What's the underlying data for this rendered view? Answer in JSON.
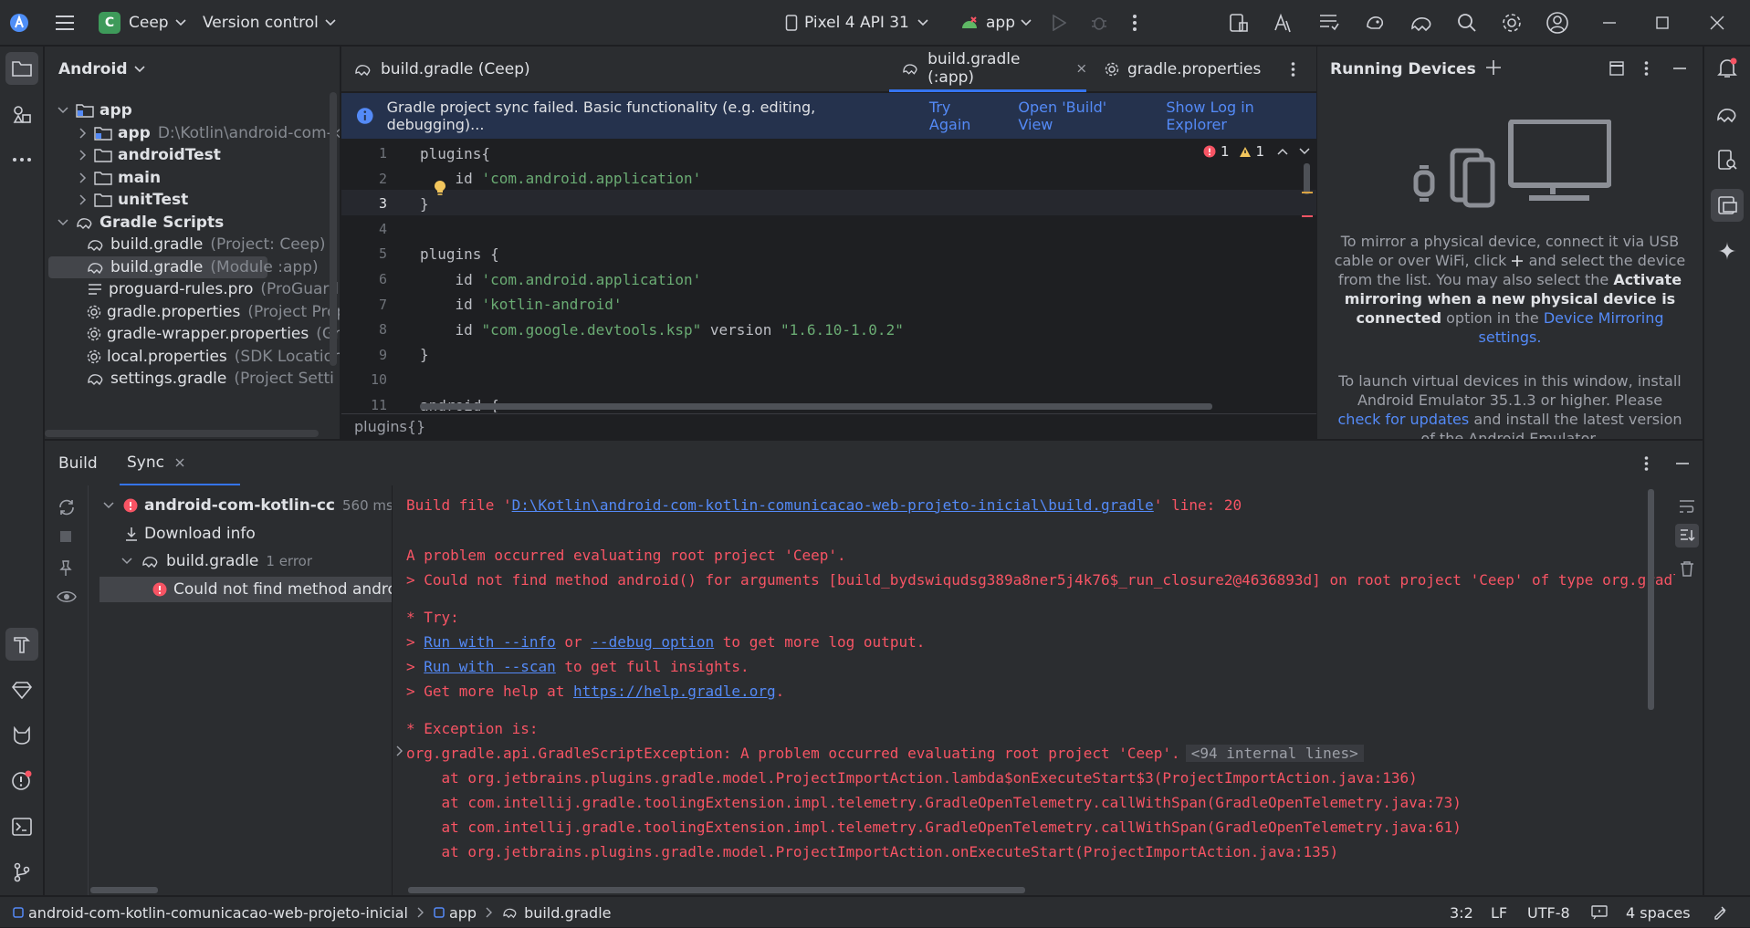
{
  "titlebar": {
    "project_badge": "C",
    "project_name": "Ceep",
    "vcs_label": "Version control",
    "device": "Pixel 4 API 31",
    "run_config": "app"
  },
  "project_panel": {
    "view_label": "Android",
    "tree": [
      {
        "label": "app",
        "hint": "",
        "level": 0,
        "expanded": true,
        "icon": "folder-module-icon"
      },
      {
        "label": "app",
        "hint": "D:\\Kotlin\\android-com-ko",
        "level": 1,
        "expanded": false,
        "icon": "folder-module-icon"
      },
      {
        "label": "androidTest",
        "hint": "",
        "level": 1,
        "expanded": false,
        "icon": "folder-icon"
      },
      {
        "label": "main",
        "hint": "",
        "level": 1,
        "expanded": false,
        "icon": "folder-icon"
      },
      {
        "label": "unitTest",
        "hint": "",
        "level": 1,
        "expanded": false,
        "icon": "folder-icon"
      },
      {
        "label": "Gradle Scripts",
        "hint": "",
        "level": 0,
        "expanded": true,
        "icon": "gradle-icon"
      },
      {
        "label": "build.gradle",
        "hint": "(Project: Ceep)",
        "level": 1,
        "icon": "gradle-icon"
      },
      {
        "label": "build.gradle",
        "hint": "(Module :app)",
        "level": 1,
        "icon": "gradle-icon",
        "selected": true
      },
      {
        "label": "proguard-rules.pro",
        "hint": "(ProGuard R",
        "level": 1,
        "icon": "text-file-icon"
      },
      {
        "label": "gradle.properties",
        "hint": "(Project Prop",
        "level": 1,
        "icon": "gear-icon"
      },
      {
        "label": "gradle-wrapper.properties",
        "hint": "(Gra",
        "level": 1,
        "icon": "gear-icon"
      },
      {
        "label": "local.properties",
        "hint": "(SDK Location",
        "level": 1,
        "icon": "gear-icon"
      },
      {
        "label": "settings.gradle",
        "hint": "(Project Setti",
        "level": 1,
        "icon": "gradle-icon"
      }
    ]
  },
  "editor": {
    "tabs": [
      {
        "label": "build.gradle (Ceep)",
        "active": false
      },
      {
        "label": "build.gradle (:app)",
        "active": true
      },
      {
        "label": "gradle.properties",
        "active": false
      }
    ],
    "notice": {
      "text": "Gradle project sync failed. Basic functionality (e.g. editing, debugging)...",
      "try_again": "Try Again",
      "open_build": "Open 'Build' View",
      "show_log": "Show Log in Explorer"
    },
    "inspections": {
      "errors": "1",
      "warnings": "1"
    },
    "lines": [
      {
        "n": "1",
        "text": "plugins{"
      },
      {
        "n": "2",
        "text": "    id 'com.android.application'"
      },
      {
        "n": "3",
        "text": "}"
      },
      {
        "n": "4",
        "text": ""
      },
      {
        "n": "5",
        "text": "plugins {"
      },
      {
        "n": "6",
        "text": "    id 'com.android.application'"
      },
      {
        "n": "7",
        "text": "    id 'kotlin-android'"
      },
      {
        "n": "8",
        "text": "    id \"com.google.devtools.ksp\" version \"1.6.10-1.0.2\""
      },
      {
        "n": "9",
        "text": "}"
      },
      {
        "n": "10",
        "text": ""
      },
      {
        "n": "11",
        "text": "android {"
      }
    ],
    "breadcrumb": "plugins{}"
  },
  "devices": {
    "title": "Running Devices",
    "p1_a": "To mirror a physical device, connect it via USB cable or over WiFi, click",
    "p1_b": "and select the device from the list. You may also select the",
    "p1_bold": "Activate mirroring when a new physical device is connected",
    "p1_c": "option in the",
    "p1_link": "Device Mirroring settings.",
    "p2_a": "To launch virtual devices in this window, install Android Emulator 35.1.3 or higher. Please",
    "p2_link": "check for updates",
    "p2_b": "and install the latest version of the Android Emulator."
  },
  "build": {
    "tab_build": "Build",
    "tab_sync": "Sync",
    "tree": [
      {
        "label": "android-com-kotlin-cc",
        "hint": "560 ms",
        "level": 0
      },
      {
        "label": "Download info",
        "hint": "",
        "level": 1
      },
      {
        "label": "build.gradle",
        "hint": "1 error",
        "level": 1
      },
      {
        "label": "Could not find method andro",
        "hint": "",
        "level": 2
      }
    ],
    "console": {
      "l1_pre": "Build file '",
      "l1_link": "D:\\Kotlin\\android-com-kotlin-comunicacao-web-projeto-inicial\\build.gradle",
      "l1_post": "' line: 20",
      "l2": "A problem occurred evaluating root project 'Ceep'.",
      "l3": "> Could not find method android() for arguments [build_bydswiqudsg389a8ner5j4k76$_run_closure2@4636893d] on root project 'Ceep' of type org.gradle.api.Project.",
      "l4": "* Try:",
      "l5_pre": "> ",
      "l5_link1": "Run with --info",
      "l5_mid": " or ",
      "l5_link2": "--debug option",
      "l5_post": " to get more log output.",
      "l6_pre": "> ",
      "l6_link": "Run with --scan",
      "l6_post": " to get full insights.",
      "l7_pre": "> Get more help at ",
      "l7_link": "https://help.gradle.org",
      "l7_post": ".",
      "l8": "* Exception is:",
      "l9": "org.gradle.api.GradleScriptException: A problem occurred evaluating root project 'Ceep'.",
      "l9_tag": "<94 internal lines>",
      "l10": "    at org.jetbrains.plugins.gradle.model.ProjectImportAction.lambda$onExecuteStart$3(ProjectImportAction.java:136)",
      "l11": "    at com.intellij.gradle.toolingExtension.impl.telemetry.GradleOpenTelemetry.callWithSpan(GradleOpenTelemetry.java:73)",
      "l12": "    at com.intellij.gradle.toolingExtension.impl.telemetry.GradleOpenTelemetry.callWithSpan(GradleOpenTelemetry.java:61)",
      "l13": "    at org.jetbrains.plugins.gradle.model.ProjectImportAction.onExecuteStart(ProjectImportAction.java:135)"
    }
  },
  "statusbar": {
    "crumb_project": "android-com-kotlin-comunicacao-web-projeto-inicial",
    "crumb_module": "app",
    "crumb_file": "build.gradle",
    "position": "3:2",
    "line_sep": "LF",
    "encoding": "UTF-8",
    "indent": "4 spaces"
  },
  "colors": {
    "error": "#f75464",
    "link": "#548af7",
    "string": "#6aab73",
    "accent": "#3574f0"
  }
}
